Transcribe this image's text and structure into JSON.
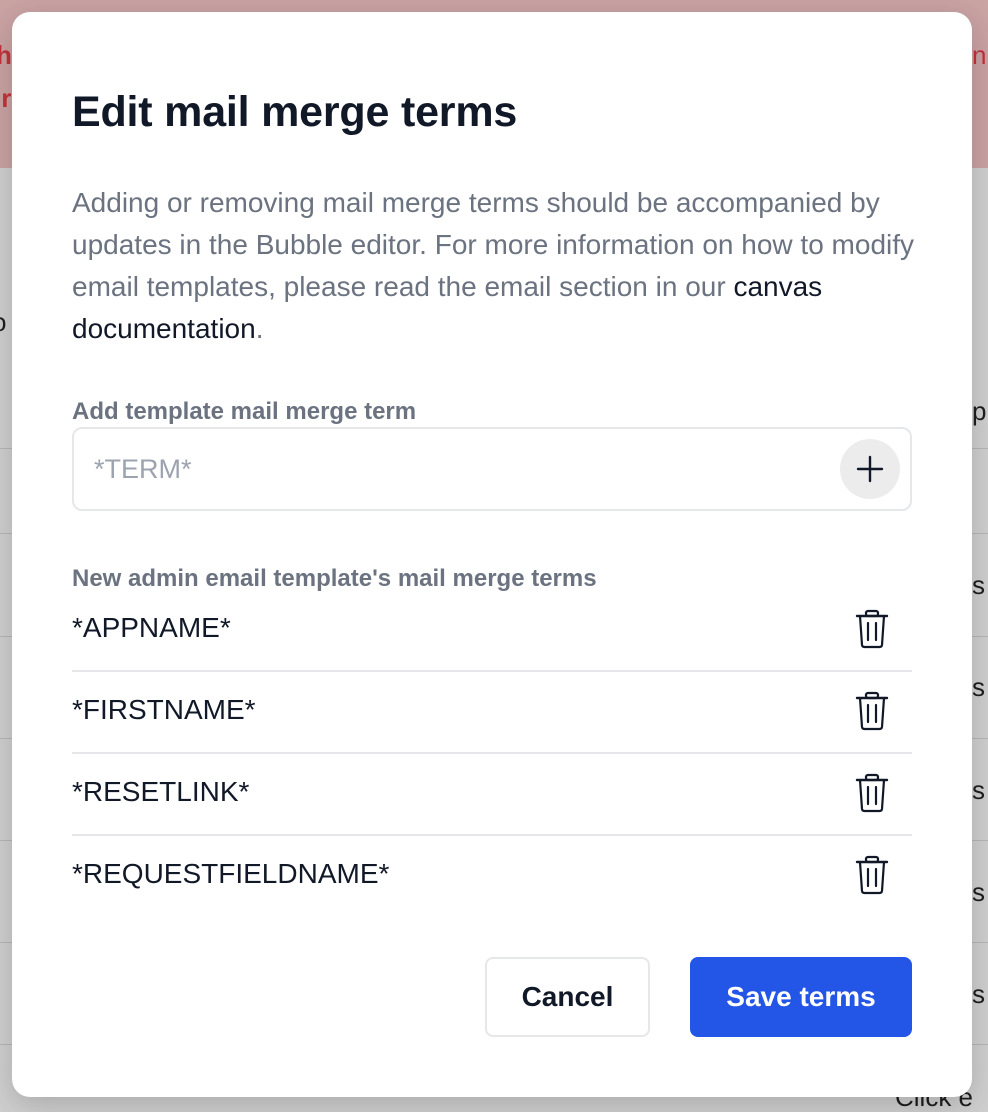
{
  "background": {
    "fragments": {
      "banner_right": "n",
      "banner_left_1": "h",
      "banner_left_2": "ir",
      "left_mid": "o",
      "right_p": "p",
      "right_s": "s",
      "bottom_right": "Click e"
    }
  },
  "modal": {
    "title": "Edit mail merge terms",
    "description": {
      "text_before_link": "Adding or removing mail merge terms should be accompanied by updates in the Bubble editor. For more information on how to modify email templates, please read the email section in our ",
      "link_text": "canvas documentation",
      "text_after_link": "."
    },
    "add_field": {
      "label": "Add template mail merge term",
      "placeholder": "*TERM*",
      "value": "",
      "add_icon": "plus-icon"
    },
    "terms_section": {
      "label": "New admin email template's mail merge terms",
      "delete_icon": "trash-icon",
      "terms": [
        "*APPNAME*",
        "*FIRSTNAME*",
        "*RESETLINK*",
        "*REQUESTFIELDNAME*"
      ]
    },
    "buttons": {
      "cancel": "Cancel",
      "save": "Save terms"
    }
  },
  "colors": {
    "primary": "#2355e6",
    "title": "#111827",
    "muted": "#6b7280",
    "border": "#e5e7eb",
    "overlay_banner": "#caa3a3",
    "alert_red": "#c3323a"
  }
}
